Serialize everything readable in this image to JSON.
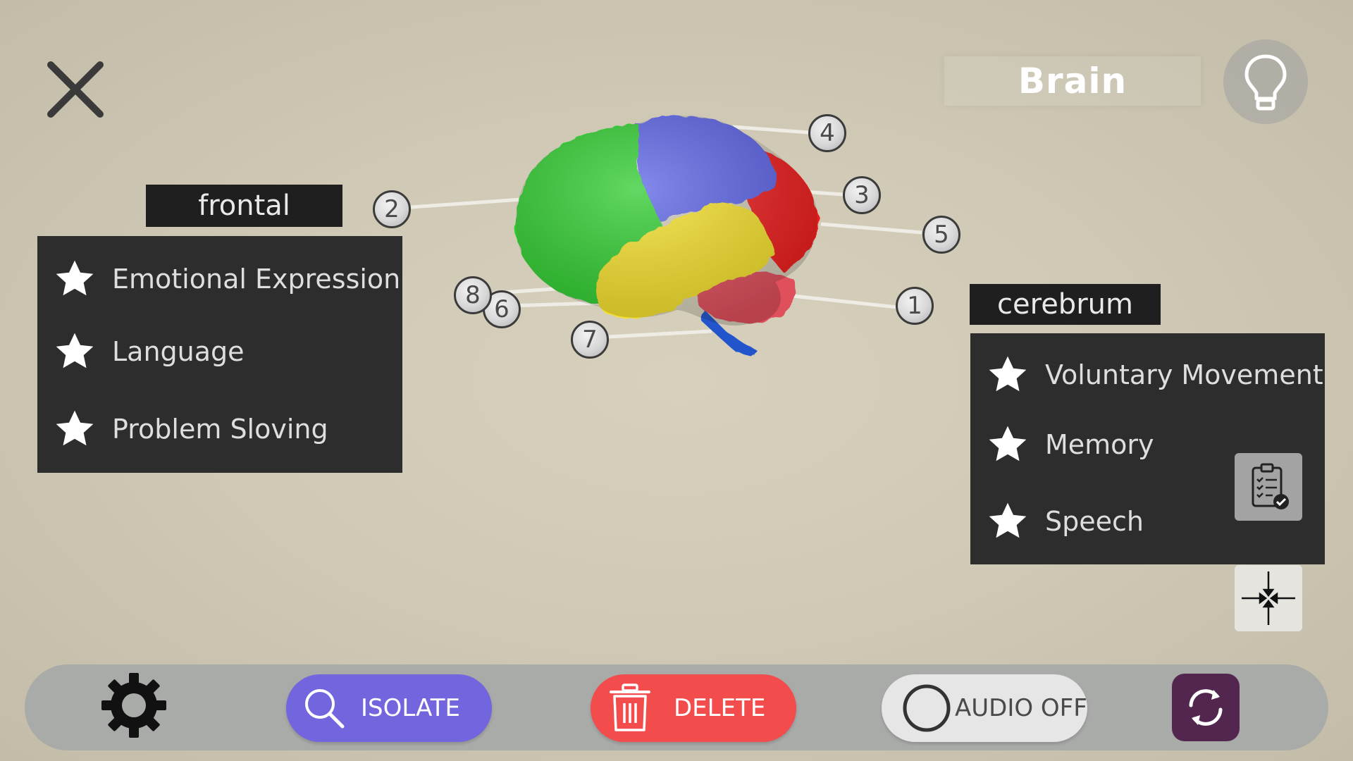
{
  "window": {
    "title": "Brain"
  },
  "colors": {
    "frontal_lobe": "#2ecc2e",
    "parietal_lobe": "#5b63e6",
    "occipital_lobe": "#ee1e1e",
    "temporal_lobe": "#f5e02a",
    "cerebellum": "#e0505c",
    "brainstem": "#2255cc",
    "isolate": "#7265de",
    "delete": "#f34c4c",
    "rotate": "#52264f"
  },
  "pins": [
    "1",
    "2",
    "3",
    "4",
    "5",
    "6",
    "7",
    "8"
  ],
  "frontal_panel": {
    "heading": "frontal",
    "items": [
      "Emotional Expression",
      "Language",
      "Problem Sloving"
    ]
  },
  "cerebrum_panel": {
    "heading": "cerebrum",
    "items": [
      "Voluntary Movement",
      "Memory",
      "Speech"
    ]
  },
  "icons": {
    "close": "close-icon",
    "hint": "lightbulb-icon",
    "star": "star-icon",
    "clipboard": "clipboard-check-icon",
    "recenter": "compress-arrows-icon",
    "settings": "gear-icon",
    "search": "search-icon",
    "trash": "trash-icon",
    "audio": "toggle-circle-icon",
    "rotate": "rotate-icon"
  },
  "toolbar": {
    "isolate_label": "ISOLATE",
    "delete_label": "DELETE",
    "audio_label": "AUDIO OFF"
  }
}
